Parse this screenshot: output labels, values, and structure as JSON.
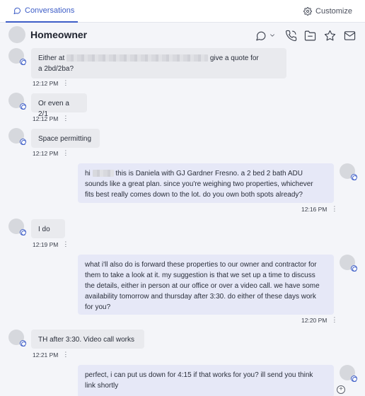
{
  "tabs": {
    "conversations_label": "Conversations",
    "customize_label": "Customize"
  },
  "header": {
    "contact_name": "Homeowner"
  },
  "messages": [
    {
      "direction": "in",
      "text_pre": "Either at",
      "text_post": "give a quote for",
      "text_line2": "a 2bd/2ba?",
      "time": "12:12 PM"
    },
    {
      "direction": "in",
      "text": "Or even a 2/1",
      "time": "12:12 PM"
    },
    {
      "direction": "in",
      "text": "Space permitting",
      "time": "12:12 PM"
    },
    {
      "direction": "out",
      "text_pre": "hi",
      "text_post": "this is Daniela with GJ Gardner Fresno. a 2 bed 2 bath ADU",
      "text_line2": "sounds like a great plan. since you're weighing two properties, whichever",
      "text_line3": "fits best really comes down to the lot. do you own both spots already?",
      "time": "12:16 PM"
    },
    {
      "direction": "in",
      "text": "I do",
      "time": "12:19 PM"
    },
    {
      "direction": "out",
      "lines": [
        "what i'll also do is forward these properties to our owner and contractor for",
        "them to take a look at it. my suggestion is that we set up a time to discuss",
        "the details, either in person at our office or over a video call. we have some",
        "availability tomorrow and thursday after 3:30. do either of these days work",
        "for you?"
      ],
      "time": "12:20 PM"
    },
    {
      "direction": "in",
      "text": "TH after 3:30. Video call works",
      "time": "12:21 PM"
    },
    {
      "direction": "out",
      "lines": [
        "perfect, i can put us down for 4:15 if that works for you? ill send you think",
        "link shortly"
      ]
    }
  ],
  "icons": {
    "conversations_tab": "chat-bubble-icon",
    "customize": "gear-icon",
    "header": [
      "chat-bubble-icon",
      "chevron-down-icon",
      "phone-icon",
      "folder-icon",
      "star-icon",
      "mail-icon"
    ],
    "more": "more-vertical-icon",
    "add": "plus-circle-icon"
  },
  "colors": {
    "accent": "#3d5dc7",
    "incoming_bubble": "#e9eaee",
    "outgoing_bubble": "#e6e8f7",
    "background": "#f4f5f9"
  }
}
